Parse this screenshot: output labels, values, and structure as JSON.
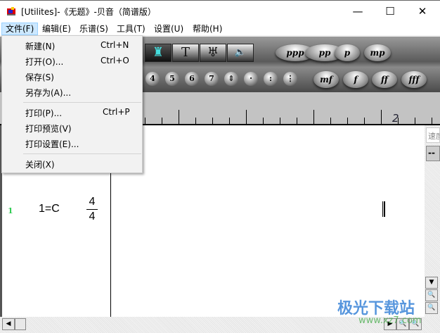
{
  "window": {
    "title": "[Utilites]-《无题》-贝音（简谱版）",
    "minimize": "—",
    "maximize": "☐",
    "close": "✕"
  },
  "menubar": [
    {
      "label": "文件(F)"
    },
    {
      "label": "编辑(E)"
    },
    {
      "label": "乐谱(S)"
    },
    {
      "label": "工具(T)"
    },
    {
      "label": "设置(U)"
    },
    {
      "label": "帮助(H)"
    }
  ],
  "file_menu": {
    "items": [
      {
        "label": "新建(N)",
        "shortcut": "Ctrl+N"
      },
      {
        "label": "打开(O)...",
        "shortcut": "Ctrl+O"
      },
      {
        "label": "保存(S)",
        "shortcut": ""
      },
      {
        "label": "另存为(A)...",
        "shortcut": ""
      },
      {
        "label": "打印(P)...",
        "shortcut": "Ctrl+P"
      },
      {
        "label": "打印预览(V)",
        "shortcut": ""
      },
      {
        "label": "打印设置(E)...",
        "shortcut": ""
      },
      {
        "label": "关闭(X)",
        "shortcut": ""
      }
    ]
  },
  "toolbar": {
    "tools": [
      {
        "icon": "metronome-icon",
        "glyph": "♜"
      },
      {
        "icon": "text-icon",
        "glyph": "T"
      },
      {
        "icon": "lyre-icon",
        "glyph": "♅"
      },
      {
        "icon": "speaker-icon",
        "glyph": "🔈"
      }
    ],
    "dynamics_top": [
      "ppp",
      "pp",
      "p",
      "mp"
    ],
    "dynamics_bottom": [
      "mf",
      "f",
      "ff",
      "fff"
    ],
    "numbers": [
      "4",
      "5",
      "6",
      "7"
    ],
    "symbols": [
      "⇕",
      "·",
      ":",
      "⋮"
    ]
  },
  "ruler": {
    "measure_label": "2"
  },
  "score": {
    "line_number": "1",
    "key": "1=C",
    "time_top": "4",
    "time_bottom": "4"
  },
  "tooltip": {
    "text": "速度",
    "value": "--"
  },
  "watermark": {
    "text": "极光下载站",
    "url": "www.xz7.com"
  }
}
